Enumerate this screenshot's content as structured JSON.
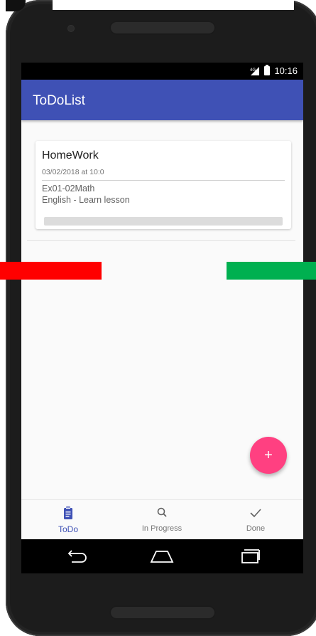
{
  "status_bar": {
    "network": "4G",
    "time": "10:16"
  },
  "app_bar": {
    "title": "ToDoList"
  },
  "card": {
    "title": "HomeWork",
    "date": "03/02/2018 at 10:0",
    "lines": [
      "Ex01-02Math",
      "English - Learn lesson"
    ],
    "progress": 0
  },
  "fab": {
    "label": "+",
    "icon": "plus-icon",
    "color": "#ff4081"
  },
  "bottom_nav": {
    "items": [
      {
        "label": "ToDo",
        "icon": "clipboard-icon",
        "active": true
      },
      {
        "label": "In Progress",
        "icon": "search-icon",
        "active": false
      },
      {
        "label": "Done",
        "icon": "check-icon",
        "active": false
      }
    ]
  },
  "system_nav": {
    "buttons": [
      "back-icon",
      "home-icon",
      "recents-icon"
    ]
  },
  "colors": {
    "primary": "#3f51b5",
    "accent": "#ff4081",
    "swipe_left": "#ff0000",
    "swipe_right": "#00b050"
  }
}
